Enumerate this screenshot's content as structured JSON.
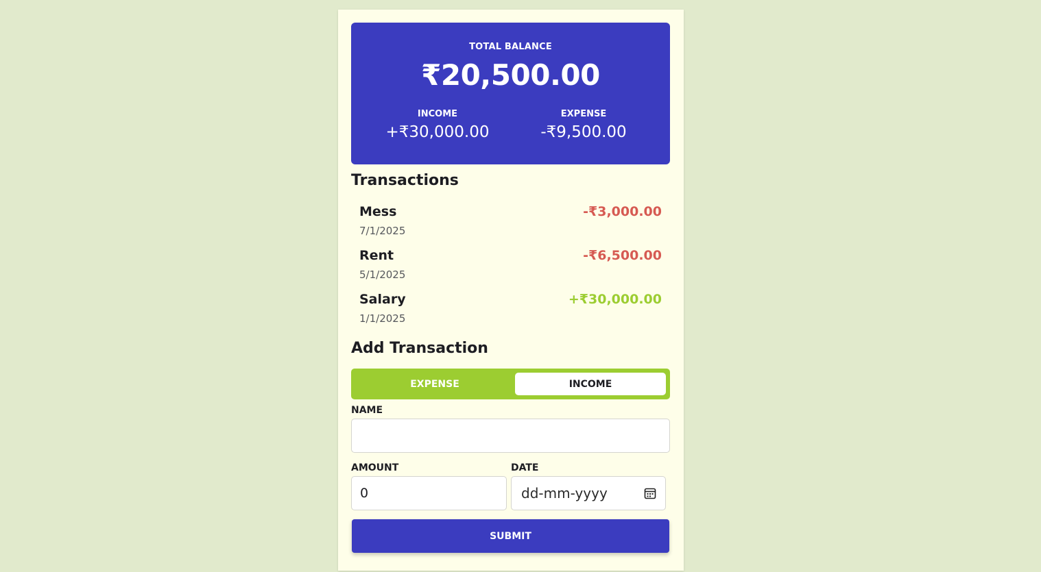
{
  "balance": {
    "label": "TOTAL BALANCE",
    "value": "₹20,500.00",
    "income_label": "INCOME",
    "income_value": "+₹30,000.00",
    "expense_label": "EXPENSE",
    "expense_value": "-₹9,500.00"
  },
  "transactions": {
    "title": "Transactions",
    "items": [
      {
        "name": "Mess",
        "date": "7/1/2025",
        "amount": "-₹3,000.00",
        "type": "expense"
      },
      {
        "name": "Rent",
        "date": "5/1/2025",
        "amount": "-₹6,500.00",
        "type": "expense"
      },
      {
        "name": "Salary",
        "date": "1/1/2025",
        "amount": "+₹30,000.00",
        "type": "income"
      }
    ]
  },
  "form": {
    "title": "Add Transaction",
    "toggle": {
      "expense_label": "EXPENSE",
      "income_label": "INCOME",
      "selected": "INCOME"
    },
    "name_label": "NAME",
    "name_value": "",
    "amount_label": "AMOUNT",
    "amount_value": "0",
    "date_label": "DATE",
    "date_placeholder": "dd-mm-yyyy",
    "submit_label": "SUBMIT"
  },
  "colors": {
    "page_bg": "#e1eacc",
    "app_bg": "#fefee9",
    "accent": "#3b3cbf",
    "toggle_bg": "#9ccd31",
    "expense": "#d65a52",
    "income": "#9ccd31"
  },
  "icons": {
    "date": "calendar-icon"
  }
}
